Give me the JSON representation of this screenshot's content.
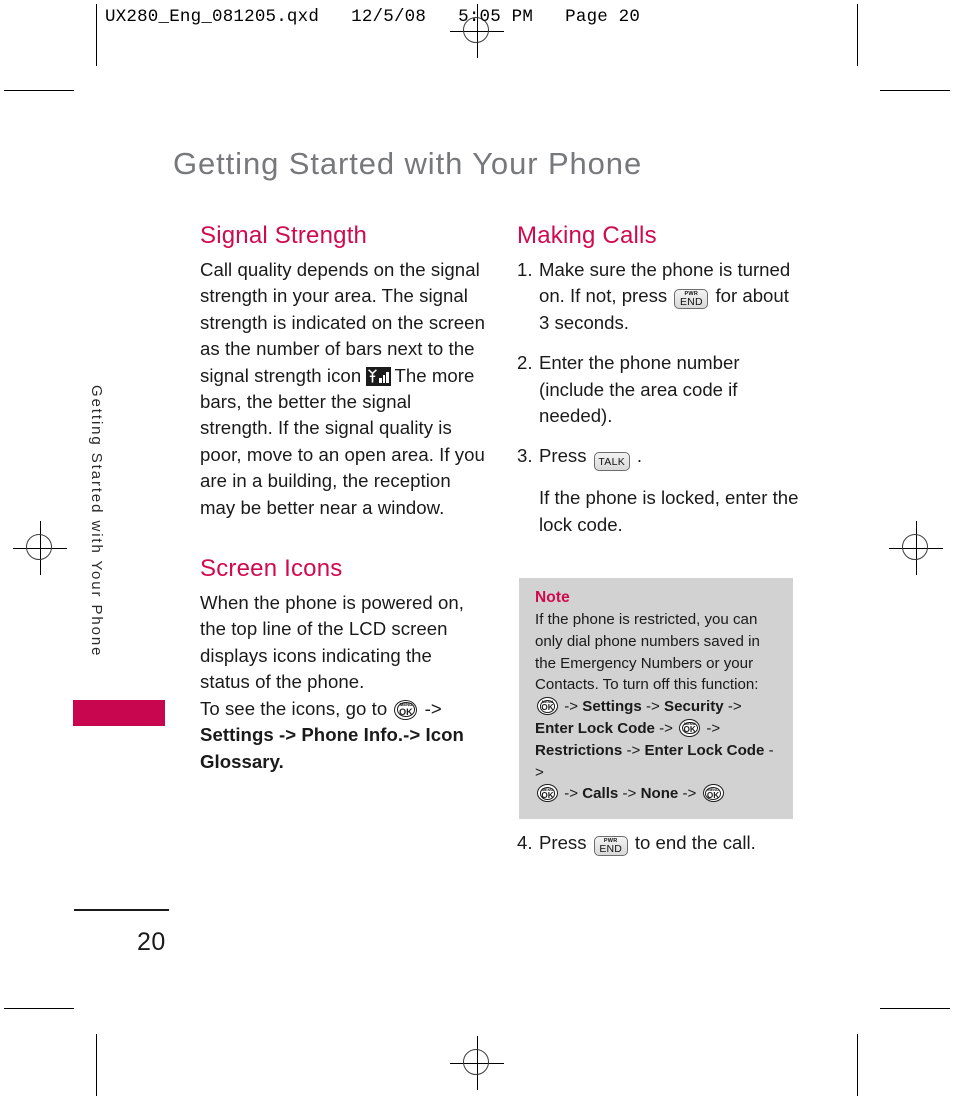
{
  "printer_marks": {
    "registration_icon": "registration-target-icon",
    "crop_mark_icon": "crop-mark-icon"
  },
  "running_head": "UX280_Eng_081205.qxd   12/5/08   5:05 PM   Page 20",
  "page_title": "Getting Started with Your Phone",
  "side_tab": {
    "label": "Getting Started with Your Phone",
    "accent_color": "#c8064f"
  },
  "colors": {
    "heading": "#d10a4e",
    "title_gray": "#77787b",
    "note_background": "#d2d2d2",
    "body_text": "#1a1a1a"
  },
  "left_column": {
    "sections": [
      {
        "heading": "Signal Strength",
        "paragraph_before_icon": "Call quality depends on the signal strength in your area. The signal strength is indicated on the screen as the number of bars next to the signal strength icon",
        "icon": "signal-strength-icon",
        "paragraph_after_icon": "The more bars, the better the signal strength. If the signal quality is poor, move to an open area. If you are in a building, the reception may be better near a window."
      },
      {
        "heading": "Screen Icons",
        "paragraph_1": "When the phone is powered on, the top line of the LCD screen displays icons indicating the status of the phone.",
        "paragraph_2_prefix": "To see the icons, go to",
        "menu_ok_key": {
          "top": "MENU",
          "main": "OK"
        },
        "arrow": "->",
        "path_1": "Settings",
        "path_2": "Phone Info.",
        "path_3": "Icon Glossary."
      }
    ]
  },
  "right_column": {
    "heading": "Making Calls",
    "steps": [
      {
        "number": "1.",
        "text_before_key": "Make sure the phone is turned on. If not, press",
        "key": {
          "top": "PWR",
          "main": "END"
        },
        "text_after_key": "for about 3 seconds."
      },
      {
        "number": "2.",
        "text_before_key": "Enter the phone number (include the area code if needed).",
        "key": null,
        "text_after_key": ""
      },
      {
        "number": "3.",
        "text_before_key": "Press",
        "key": {
          "top": "",
          "main": "TALK"
        },
        "text_after_key": "."
      },
      {
        "number": "4.",
        "text_before_key": "Press",
        "key": {
          "top": "PWR",
          "main": "END"
        },
        "text_after_key": "to end the call."
      }
    ],
    "step3_follow_up": "If the phone is locked, enter the lock code."
  },
  "note": {
    "title": "Note",
    "body": "If the phone is restricted, you can only dial phone numbers saved in the Emergency Numbers or your Contacts. To turn off this function:",
    "menu_ok_key": {
      "top": "MENU",
      "main": "OK"
    },
    "arrow": "->",
    "path_items": [
      "Settings",
      "Security",
      "Enter Lock Code",
      "Restrictions",
      "Enter Lock Code",
      "Calls",
      "None"
    ]
  },
  "footer": {
    "page_number": "20"
  }
}
